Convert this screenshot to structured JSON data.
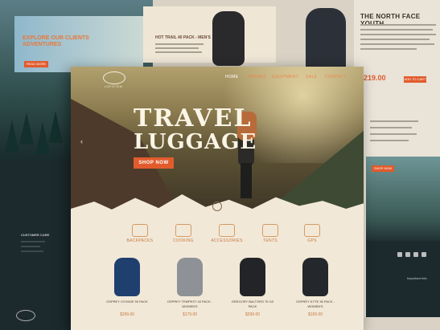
{
  "background_left": {
    "promo_title": "EXPLORE OUR CLIENTS ADVENTURES",
    "promo_button": "READ MORE",
    "footer_label": "CUSTOMER CARE"
  },
  "background_middle": {
    "product_title": "HOT TRAIL 40 PACK - MEN'S"
  },
  "background_right": {
    "title": "THE NORTH FACE YOUTH",
    "price": "219.00",
    "cart_button": "ADD TO CART",
    "shop_button": "SHOP NOW",
    "important_label": "Important Info"
  },
  "nav": {
    "logo_text": "LOFOTEN",
    "items": [
      "HOME",
      "BRANDS",
      "EQUIPMENT",
      "SALE",
      "CONTACT"
    ]
  },
  "hero": {
    "title_line1": "TRAVEL",
    "title_line2": "LUGGAGE",
    "button": "SHOP NOW"
  },
  "categories": [
    {
      "label": "BACKPACKS",
      "icon": "backpack-icon"
    },
    {
      "label": "COOKING",
      "icon": "cooking-icon"
    },
    {
      "label": "ACCESSORIES",
      "icon": "accessories-icon"
    },
    {
      "label": "TENTS",
      "icon": "tent-icon"
    },
    {
      "label": "GPS",
      "icon": "gps-icon"
    }
  ],
  "products": [
    {
      "name": "OSPREY VOYAGE 50 PACK",
      "price": "$299.00",
      "color": "#1f3f6e"
    },
    {
      "name": "OSPREY TEMPEST 40 PACK - WOMEN'S",
      "price": "$179.00",
      "color": "#8e9296"
    },
    {
      "name": "GREGORY BALTORO 75 GZ PACK",
      "price": "$299.00",
      "color": "#232427"
    },
    {
      "name": "OSPREY KYTE 36 PACK - WOMEN'S",
      "price": "$159.00",
      "color": "#24272b"
    }
  ],
  "colors": {
    "accent": "#e25b2c",
    "cream": "#f1e8d8",
    "dark": "#1c2a2e"
  }
}
